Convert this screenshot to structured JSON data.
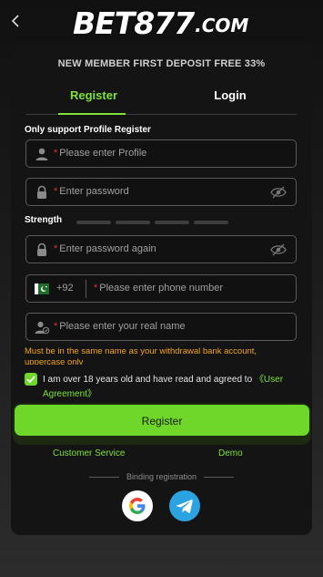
{
  "header": {
    "back_icon": "chevron-left-icon",
    "logo_main": "BET877",
    "logo_suffix": ".COM"
  },
  "promo": "NEW MEMBER FIRST DEPOSIT FREE 33%",
  "tabs": {
    "register": "Register",
    "login": "Login"
  },
  "note": "Only support Profile Register",
  "fields": {
    "profile": {
      "star": "*",
      "placeholder": "Please enter Profile"
    },
    "password": {
      "star": "*",
      "placeholder": "Enter password"
    },
    "password_again": {
      "star": "*",
      "placeholder": "Enter password again"
    },
    "phone": {
      "code": "+92",
      "star": "*",
      "placeholder": "Please enter phone number"
    },
    "real_name": {
      "star": "*",
      "placeholder": "Please enter your real name"
    }
  },
  "strength_label": "Strength",
  "warning": "Must be in the same name as your withdrawal bank account, uppercase only",
  "agree": {
    "text": "I am over 18 years old and have read and agreed to ",
    "link": "《User Agreement》"
  },
  "register_button": "Register",
  "customer_service": "Customer Service",
  "demo": "Demo",
  "binding": "Binding registration",
  "colors": {
    "accent": "#6fd62a",
    "warning": "#f2a51f",
    "required": "#e0342e"
  }
}
